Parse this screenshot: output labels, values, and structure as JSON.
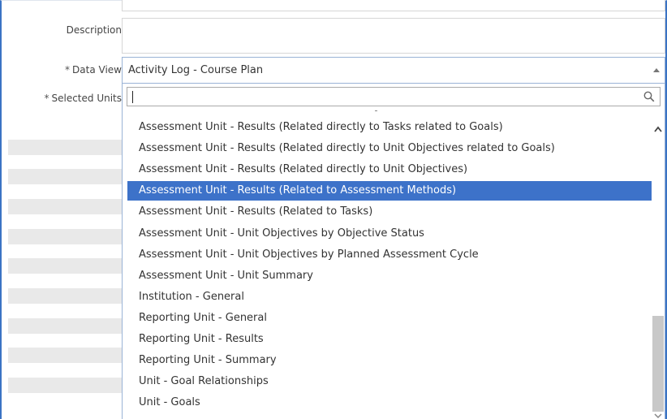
{
  "form": {
    "description_label": "Description",
    "data_view_label": "Data View",
    "selected_units_label": "Selected Units",
    "required_marker": "*"
  },
  "data_view_select": {
    "selected_value": "Activity Log - Course Plan"
  },
  "dropdown": {
    "search_value": "",
    "selected_index": 3,
    "options": [
      "Assessment Unit - Results (Related directly to Tasks related to Goals)",
      "Assessment Unit - Results (Related directly to Unit Objectives related to Goals)",
      "Assessment Unit - Results (Related directly to Unit Objectives)",
      "Assessment Unit - Results (Related to Assessment Methods)",
      "Assessment Unit - Results (Related to Tasks)",
      "Assessment Unit - Unit Objectives by Objective Status",
      "Assessment Unit - Unit Objectives by Planned Assessment Cycle",
      "Assessment Unit - Unit Summary",
      "Institution - General",
      "Reporting Unit - General",
      "Reporting Unit - Results",
      "Reporting Unit - Summary",
      "Unit - Goal Relationships",
      "Unit - Goals"
    ]
  },
  "colors": {
    "selection": "#3d72c9",
    "focus_border": "#9ab3d6",
    "frame_accent": "#3b73c4"
  },
  "icons": {
    "search": "search-icon",
    "select_arrow": "chevron-up-icon",
    "scroll_up": "chevron-up-icon"
  }
}
